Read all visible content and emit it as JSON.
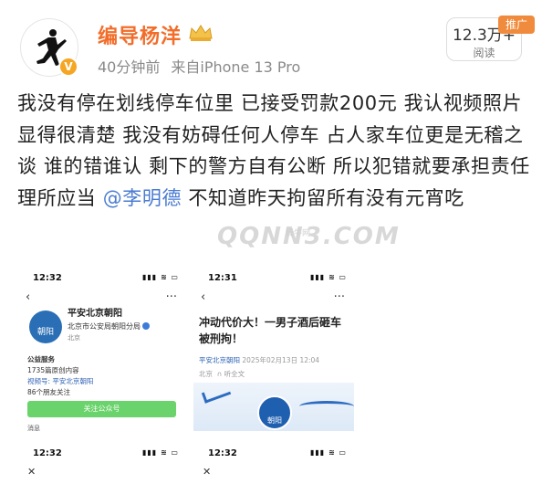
{
  "header": {
    "username": "编导杨洋",
    "time_ago": "40分钟前",
    "source": "来自iPhone 13 Pro",
    "reads_count": "12.3万+",
    "reads_label": "阅读",
    "ad_badge": "推广",
    "verified_mark": "V"
  },
  "post": {
    "text_before": "我没有停在划线停车位里 已接受罚款200元 我认视频照片显得很清楚 我没有妨碍任何人停车 占人家车位更是无稽之谈 谁的错谁认 剩下的警方自有公断 所以犯错就要承担责任 理所应当 ",
    "mention": "@李明德",
    "text_after": " 不知道昨天拘留所有没有元宵吃"
  },
  "watermark": {
    "text": "QQNN3.COM",
    "sub": "腾牛网"
  },
  "shots": {
    "s1": {
      "time": "12:32",
      "signal": "▮▮▮ ≋ ▭",
      "back": "‹",
      "more": "···",
      "account_name": "平安北京朝阳",
      "org": "北京市公安局朝阳分局",
      "location": "北京",
      "avatar_text": "朝阳",
      "line1": "公益服务",
      "line2": "1735篇原创内容",
      "line3": "视频号: 平安北京朝阳",
      "line4": "86个朋友关注",
      "follow_button": "关注公众号",
      "tab": "消息"
    },
    "s2": {
      "time": "12:31",
      "signal": "▮▮▮ ≋ ▭",
      "back": "‹",
      "more": "···",
      "title": "冲动代价大！一男子酒后砸车被刑拘！",
      "account": "平安北京朝阳",
      "date": "2025年02月13日 12:04",
      "location": "北京",
      "listen": "听全文",
      "badge_text": "朝阳"
    },
    "s3": {
      "time": "12:32",
      "signal": "▮▮▮ ≋ ▭",
      "close": "✕"
    },
    "s4": {
      "time": "12:32",
      "signal": "▮▮▮ ≋ ▭",
      "close": "✕"
    }
  }
}
